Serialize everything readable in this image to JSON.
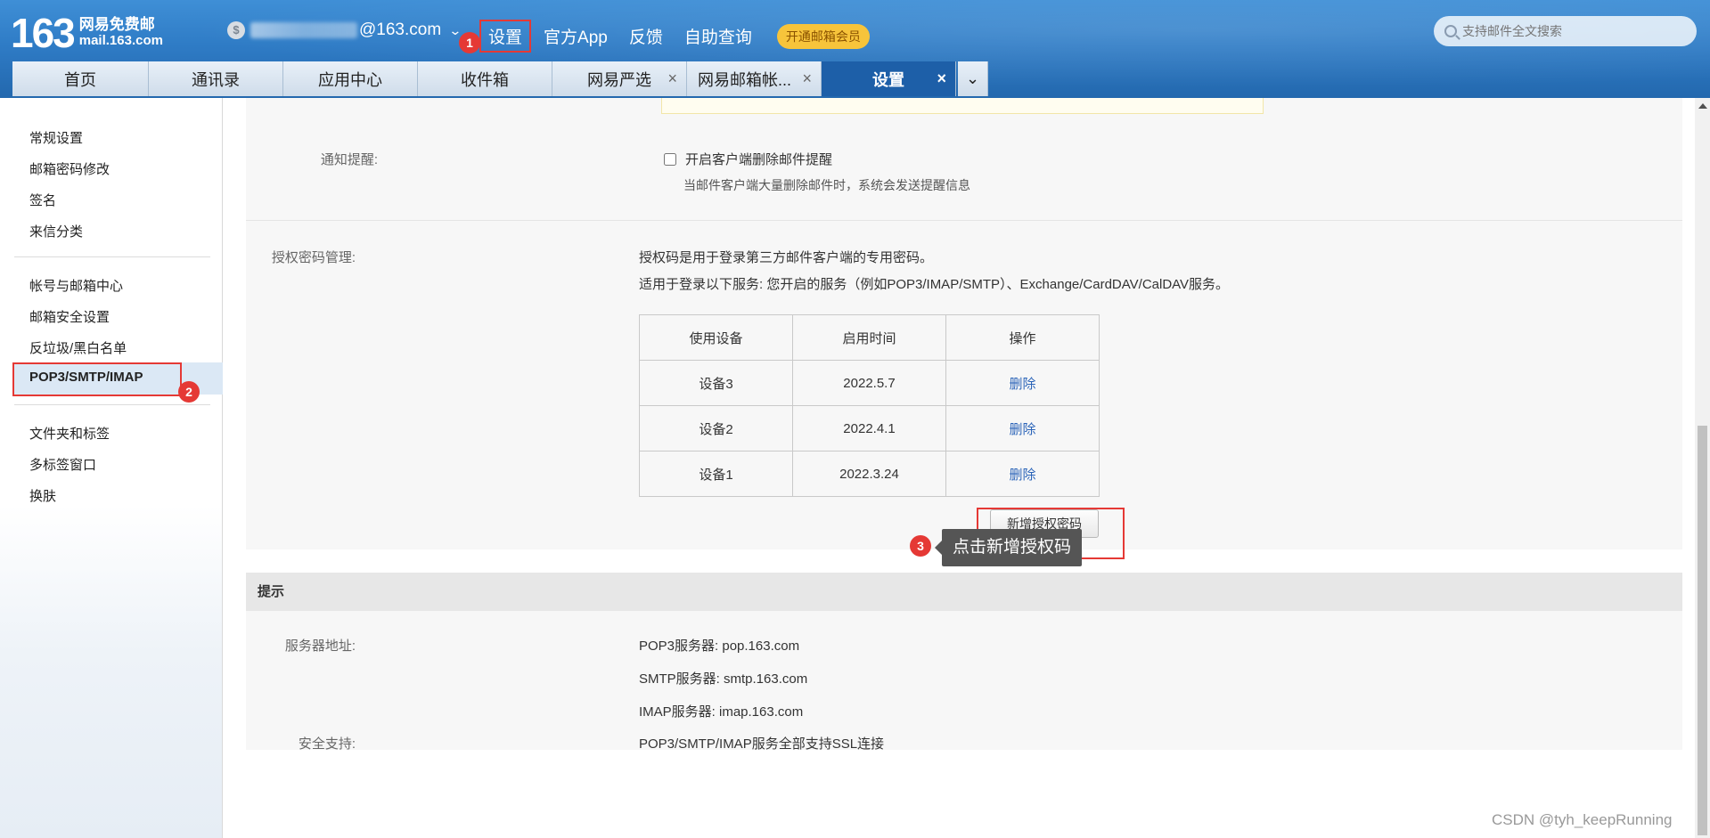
{
  "header": {
    "logo_number": "163",
    "logo_line1": "网易免费邮",
    "logo_line2": "mail.163.com",
    "account_suffix": "@163.com",
    "nav": [
      "设置",
      "官方App",
      "反馈",
      "自助查询"
    ],
    "vip_label": "开通邮箱会员",
    "search_placeholder": "支持邮件全文搜索"
  },
  "tabs": [
    {
      "label": "首页",
      "closable": false,
      "active": false
    },
    {
      "label": "通讯录",
      "closable": false,
      "active": false
    },
    {
      "label": "应用中心",
      "closable": false,
      "active": false
    },
    {
      "label": "收件箱",
      "closable": false,
      "active": false
    },
    {
      "label": "网易严选",
      "closable": true,
      "active": false
    },
    {
      "label": "网易邮箱帐...",
      "closable": true,
      "active": false
    },
    {
      "label": "设置",
      "closable": true,
      "active": true
    }
  ],
  "tab_close_glyph": "×",
  "sidebar": {
    "group1": [
      "常规设置",
      "邮箱密码修改",
      "签名",
      "来信分类"
    ],
    "group2": [
      "帐号与邮箱中心",
      "邮箱安全设置",
      "反垃圾/黑白名单",
      "POP3/SMTP/IMAP"
    ],
    "group3": [
      "文件夹和标签",
      "多标签窗口",
      "换肤"
    ]
  },
  "notify": {
    "label": "通知提醒:",
    "checkbox_label": "开启客户端删除邮件提醒",
    "desc": "当邮件客户端大量删除邮件时，系统会发送提醒信息"
  },
  "auth": {
    "label": "授权密码管理:",
    "line1": "授权码是用于登录第三方邮件客户端的专用密码。",
    "line2": "适用于登录以下服务: 您开启的服务（例如POP3/IMAP/SMTP）、Exchange/CardDAV/CalDAV服务。",
    "columns": [
      "使用设备",
      "启用时间",
      "操作"
    ],
    "rows": [
      {
        "device": "设备3",
        "time": "2022.5.7",
        "action": "删除"
      },
      {
        "device": "设备2",
        "time": "2022.4.1",
        "action": "删除"
      },
      {
        "device": "设备1",
        "time": "2022.3.24",
        "action": "删除"
      }
    ],
    "new_button": "新增授权密码"
  },
  "annotations": {
    "badge1": "1",
    "badge2": "2",
    "badge3": "3",
    "tooltip": "点击新增授权码"
  },
  "tips": {
    "title": "提示",
    "server_label": "服务器地址:",
    "pop3": "POP3服务器: pop.163.com",
    "smtp": "SMTP服务器: smtp.163.com",
    "imap": "IMAP服务器: imap.163.com",
    "security_label": "安全支持:",
    "security": "POP3/SMTP/IMAP服务全部支持SSL连接"
  },
  "watermark": "CSDN @tyh_keepRunning",
  "colors": {
    "header_blue": "#2f7cc6",
    "active_tab": "#1d5fa8",
    "annotation_red": "#e53935",
    "link_blue": "#2a63b8",
    "vip_yellow": "#f7c43b"
  }
}
